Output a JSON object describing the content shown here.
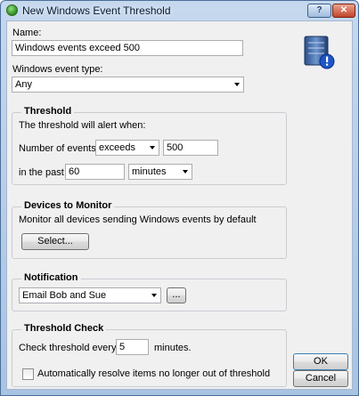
{
  "window": {
    "title": "New Windows Event Threshold",
    "help_label": "?",
    "close_label": "✕"
  },
  "name": {
    "label": "Name:",
    "value": "Windows events exceed 500"
  },
  "event_type": {
    "label": "Windows event type:",
    "value": "Any"
  },
  "threshold": {
    "legend": "Threshold",
    "description": "The threshold will alert when:",
    "number_label": "Number of events",
    "operator": "exceeds",
    "count": "500",
    "past_label": "in the past",
    "period_value": "60",
    "period_unit": "minutes"
  },
  "devices": {
    "legend": "Devices to Monitor",
    "description": "Monitor all devices sending Windows events by default",
    "select_label": "Select..."
  },
  "notification": {
    "legend": "Notification",
    "value": "Email Bob and Sue",
    "more_label": "..."
  },
  "threshold_check": {
    "legend": "Threshold Check",
    "every_label": "Check threshold every",
    "every_value": "5",
    "unit_label": "minutes.",
    "auto_resolve_label": "Automatically resolve items no longer out of threshold",
    "auto_resolve_checked": false
  },
  "buttons": {
    "ok": "OK",
    "cancel": "Cancel"
  },
  "icons": {
    "title": "green-sphere-icon",
    "corner": "server-alert-icon"
  }
}
